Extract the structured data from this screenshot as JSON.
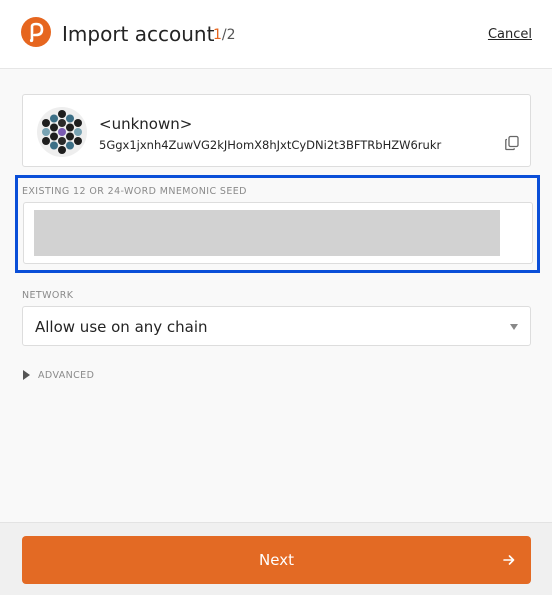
{
  "header": {
    "title": "Import account",
    "step_current": "1",
    "step_total": "/2",
    "cancel_label": "Cancel",
    "logo_icon": "polkadot-logo-icon"
  },
  "account": {
    "name": "<unknown>",
    "address": "5Ggx1jxnh4ZuwVG2kJHomX8hJxtCyDNi2t3BFTRbHZW6rukr",
    "avatar_icon": "polkadot-identicon",
    "copy_icon": "copy-icon"
  },
  "seed": {
    "label": "EXISTING 12 OR 24-WORD MNEMONIC SEED",
    "value": "",
    "highlight_color": "#0b4fd8"
  },
  "network": {
    "label": "NETWORK",
    "selected": "Allow use on any chain"
  },
  "advanced": {
    "label": "ADVANCED",
    "expanded": false
  },
  "footer": {
    "next_label": "Next",
    "button_color": "#e36a24"
  },
  "colors": {
    "accent": "#e6661f"
  }
}
